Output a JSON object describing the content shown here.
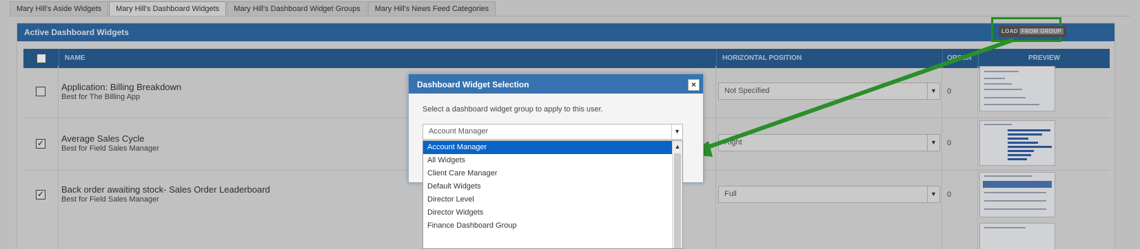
{
  "tabs": [
    {
      "label": "Mary Hill's Aside Widgets"
    },
    {
      "label": "Mary Hill's Dashboard Widgets"
    },
    {
      "label": "Mary Hill's Dashboard Widget Groups"
    },
    {
      "label": "Mary Hill's News Feed Categories"
    }
  ],
  "panel": {
    "title": "Active Dashboard Widgets",
    "load_label": "LOAD",
    "from_group_label": "FROM GROUP"
  },
  "table": {
    "headers": {
      "name": "NAME",
      "horizontal_position": "HORIZONTAL POSITION",
      "order": "ORDER",
      "preview": "PREVIEW"
    },
    "rows": [
      {
        "title": "Application: Billing Breakdown",
        "subtitle": "Best for The Billing App",
        "position": "Not Specified",
        "order": "0",
        "checked": false
      },
      {
        "title": "Average Sales Cycle",
        "subtitle": "Best for Field Sales Manager",
        "position": "Right",
        "order": "0",
        "checked": true
      },
      {
        "title": "Back order awaiting stock- Sales Order Leaderboard",
        "subtitle": "Best for Field Sales Manager",
        "position": "Full",
        "order": "0",
        "checked": true
      }
    ]
  },
  "modal": {
    "title": "Dashboard Widget Selection",
    "close": "×",
    "instruction": "Select a dashboard widget group to apply to this user.",
    "selected": "Account Manager",
    "options": [
      "Account Manager",
      "All Widgets",
      "Client Care Manager",
      "Default Widgets",
      "Director Level",
      "Director Widgets",
      "Finance Dashboard Group"
    ]
  },
  "icons": {
    "caret_down": "chevron-down-icon",
    "caret_up": "chevron-up-icon",
    "checkbox": "checkbox-icon"
  },
  "colors": {
    "header_blue": "#2f6aa5",
    "highlight_green": "#1e8e1e",
    "selected_option": "#0a64c8"
  }
}
